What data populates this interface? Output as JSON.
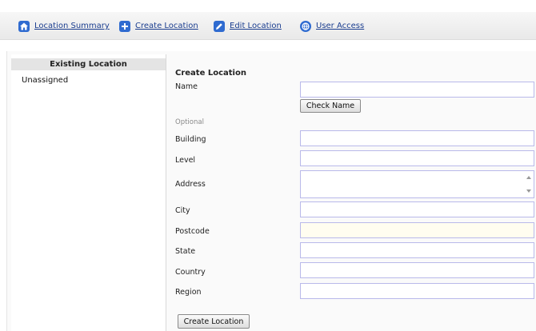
{
  "nav": {
    "location_summary": "Location Summary",
    "create_location": "Create Location",
    "edit_location": "Edit Location",
    "user_access": "User Access"
  },
  "sidebar": {
    "header": "Existing Location",
    "items": [
      "Unassigned"
    ]
  },
  "form": {
    "title": "Create Location",
    "name_label": "Name",
    "name_value": "",
    "check_name_button": "Check Name",
    "optional_label": "Optional",
    "building_label": "Building",
    "building_value": "",
    "level_label": "Level",
    "level_value": "",
    "address_label": "Address",
    "address_value": "",
    "city_label": "City",
    "city_value": "",
    "postcode_label": "Postcode",
    "postcode_value": "",
    "state_label": "State",
    "state_value": "",
    "country_label": "Country",
    "country_value": "",
    "region_label": "Region",
    "region_value": "",
    "submit_button": "Create Location"
  },
  "colors": {
    "link": "#1a3d8f",
    "field_border": "#b9b9ea",
    "icon_blue": "#2f6bd0"
  },
  "icons": {
    "location_summary": "home-icon",
    "create_location": "plus-icon",
    "edit_location": "pencil-icon",
    "user_access": "globe-icon"
  }
}
